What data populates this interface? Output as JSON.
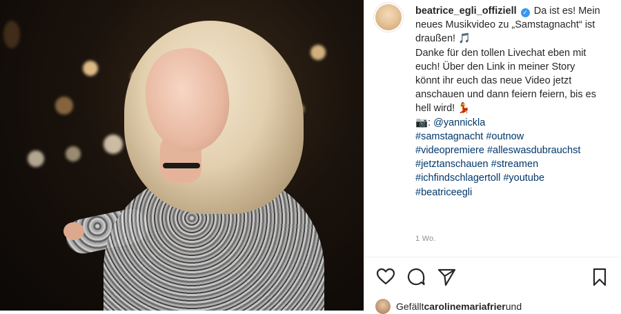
{
  "post": {
    "username": "beatrice_egli_offiziell",
    "caption_lines": [
      "Da ist es! Mein",
      "neues Musikvideo zu „Samstagnacht“ ist",
      "draußen! 🎵",
      "Danke für den tollen Livechat eben mit",
      "euch! Über den Link in meiner Story",
      "könnt ihr euch das neue Video jetzt",
      "anschauen und dann feiern feiern, bis es",
      "hell wird! 💃"
    ],
    "photo_credit_prefix": "📷: ",
    "photo_credit_handle": "@yannickla",
    "hashtag_lines": [
      "#samstagnacht #outnow",
      "#videopremiere #alleswasdubrauchst",
      "#jetztanschauen #streamen",
      "#ichfindschlagertoll #youtube",
      "#beatriceegli"
    ],
    "time_ago": "1 Wo.",
    "likes_prefix": "Gefällt ",
    "likes_user": "carolinemariafrier",
    "likes_suffix": " und"
  },
  "icons": {
    "like": "heart-icon",
    "comment": "comment-icon",
    "share": "share-icon",
    "save": "bookmark-icon",
    "verified": "verified-badge-icon"
  },
  "colors": {
    "link": "#00376b",
    "verified": "#3897f0",
    "muted": "#8e8e8e",
    "text": "#262626"
  }
}
